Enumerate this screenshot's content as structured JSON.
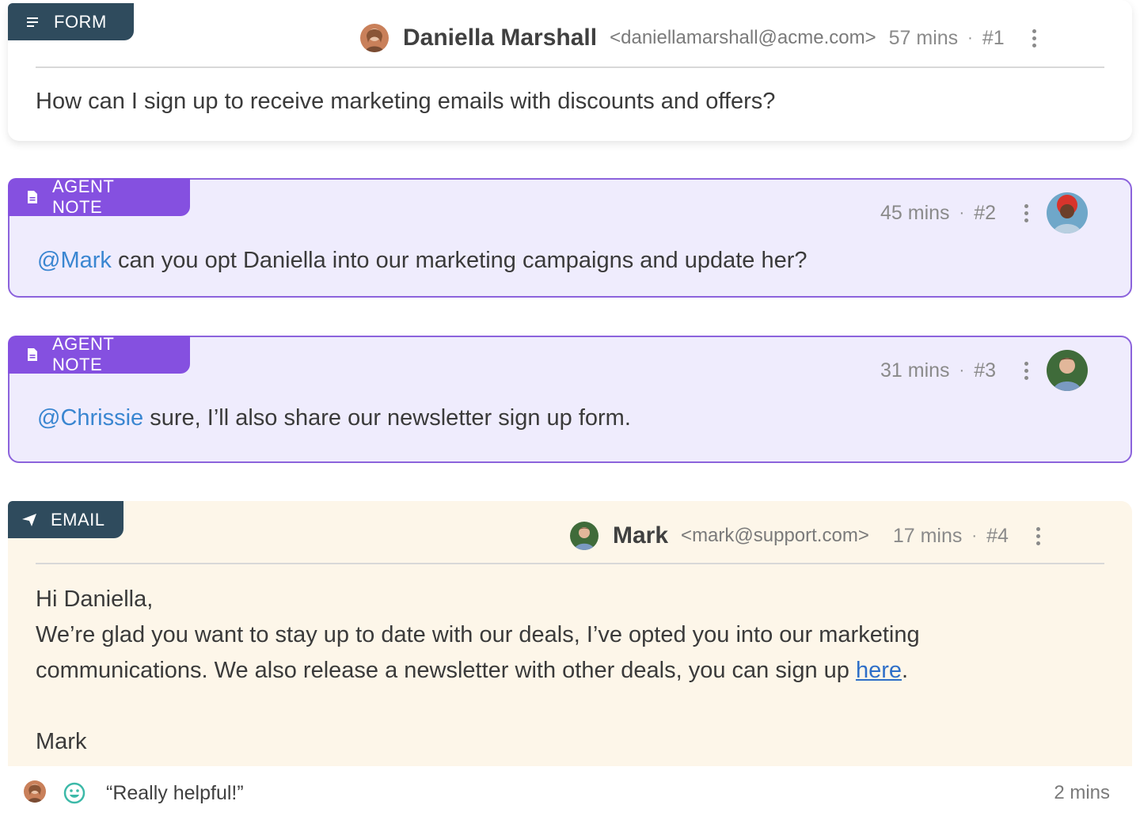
{
  "messages": [
    {
      "tag": "FORM",
      "author": "Daniella Marshall",
      "email": "<daniellamarshall@acme.com>",
      "time": "57 mins",
      "sep": "·",
      "number": "#1",
      "body": "How can I sign up to receive marketing emails with discounts and offers?"
    },
    {
      "tag": "AGENT NOTE",
      "time": "45 mins",
      "sep": "·",
      "number": "#2",
      "mention": "@Mark",
      "body": " can you opt Daniella into our marketing campaigns and update her?"
    },
    {
      "tag": "AGENT NOTE",
      "time": "31 mins",
      "sep": "·",
      "number": "#3",
      "mention": "@Chrissie",
      "body": " sure, I’ll also share our newsletter sign up form."
    },
    {
      "tag": "EMAIL",
      "author": "Mark",
      "email": "<mark@support.com>",
      "time": "17 mins",
      "sep": "·",
      "number": "#4",
      "greeting": "Hi Daniella,",
      "line1": "We’re glad you want to stay up to date with our deals, I’ve opted you into our marketing",
      "line2_pre": "communications. We also release a newsletter with other deals, you can sign up ",
      "link_text": "here",
      "line2_post": ".",
      "signature": "Mark"
    }
  ],
  "feedback": {
    "quote": "“Really helpful!”",
    "time": "2 mins",
    "icon": "smiley-icon"
  },
  "colors": {
    "form_tag": "#2f4b5d",
    "note_tag": "#8550e0",
    "note_bg": "#efecfd",
    "note_border": "#8c63dc",
    "email_bg": "#fdf6e9",
    "mention": "#3a86d1",
    "link": "#2f6fc8",
    "smiley": "#3cb9a8"
  },
  "icons": {
    "form_tag": "lines-icon",
    "note_tag": "document-icon",
    "email_tag": "paper-plane-icon",
    "menu": "kebab-menu-icon"
  }
}
